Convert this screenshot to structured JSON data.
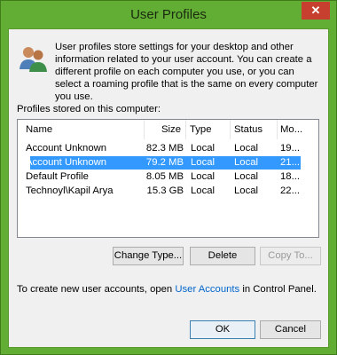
{
  "window": {
    "title": "User Profiles",
    "close_glyph": "✕"
  },
  "intro_text": "User profiles store settings for your desktop and other information related to your user account. You can create a different profile on each computer you use, or you can select a roaming profile that is the same on every computer you use.",
  "profiles_label": "Profiles stored on this computer:",
  "columns": [
    "Name",
    "Size",
    "Type",
    "Status",
    "Mo..."
  ],
  "rows": [
    {
      "name": "Account Unknown",
      "size": "82.3 MB",
      "type": "Local",
      "status": "Local",
      "modified": "19..."
    },
    {
      "name": "Account Unknown",
      "size": "79.2 MB",
      "type": "Local",
      "status": "Local",
      "modified": "21..."
    },
    {
      "name": "Default Profile",
      "size": "8.05 MB",
      "type": "Local",
      "status": "Local",
      "modified": "18..."
    },
    {
      "name": "Technoyl\\Kapil Arya",
      "size": "15.3 GB",
      "type": "Local",
      "status": "Local",
      "modified": "22..."
    }
  ],
  "selected_row_index": 1,
  "buttons": {
    "change_type": "Change Type...",
    "delete": "Delete",
    "copy_to": "Copy To...",
    "ok": "OK",
    "cancel": "Cancel"
  },
  "footer": {
    "prefix": "To create new user accounts, open ",
    "link": "User Accounts",
    "suffix": " in Control Panel."
  },
  "colors": {
    "accent_green": "#62ad34",
    "selection": "#3399ff",
    "close_button": "#c7402f",
    "link": "#0066cc"
  }
}
